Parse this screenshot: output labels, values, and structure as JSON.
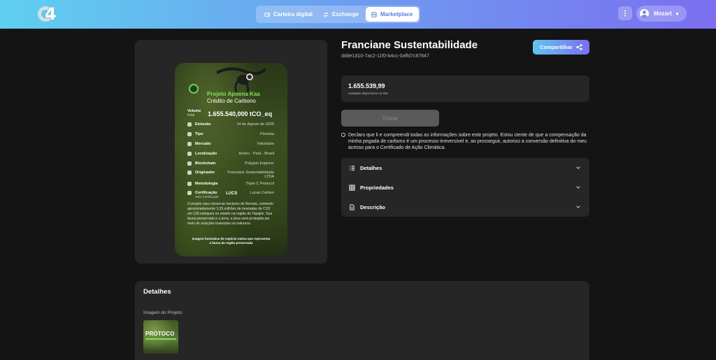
{
  "nav": {
    "tabs": [
      {
        "label": "Carteira digital",
        "icon": "wallet-icon"
      },
      {
        "label": "Exchange",
        "icon": "exchange-arrows-icon"
      },
      {
        "label": "Marketplace",
        "icon": "storefront-icon"
      }
    ],
    "active_tab": "Marketplace",
    "user_name": "Mozart"
  },
  "colors": {
    "header_gradient_start": "#5fd0f0",
    "header_gradient_end": "#7b6ef0",
    "accent_green": "#7fe05a",
    "background": "#141414",
    "panel": "#262626"
  },
  "project": {
    "title": "Franciane Sustentabilidade",
    "id": "ddde1d10-7ac2-11f0-b4cc-0affd7c87847",
    "share_label": "Compartilhar",
    "available_amount": "1.655.539,99",
    "available_label": "unidades disponíveis no lote",
    "trade_label": "Trocar",
    "consent_text": "Declaro que li e compreendi todas as informações sobre este projeto. Estou ciente de que a compensação da minha pegada de carbono é um processo irreversível e, ao prosseguir, autorizo a conversão definitiva do meu acesso para o Certificado de Ação Climática."
  },
  "accordion": [
    {
      "label": "Detalhes",
      "icon": "list-icon"
    },
    {
      "label": "Propriedades",
      "icon": "grid-icon"
    },
    {
      "label": "Descrição",
      "icon": "document-icon"
    }
  ],
  "nft_card": {
    "title": "Projeto Apoena Kaa",
    "subtitle": "Crédito de Carbono",
    "volume_label": "Volume",
    "volume_sublabel": "total",
    "volume_value": "1.655.540,000 tCO_eq",
    "rows": [
      {
        "key": "Emissão",
        "value": "14 de Agosto de 2025"
      },
      {
        "key": "Tipo",
        "value": "Floresta"
      },
      {
        "key": "Mercado",
        "value": "Voluntário"
      },
      {
        "key": "Localização",
        "value": "Aveiro - Pará - Brasil"
      },
      {
        "key": "Blockchain",
        "value": "Polygon Explorer"
      },
      {
        "key": "Originador",
        "value": "Franciane Sustentabilidade LTDA"
      },
      {
        "key": "Metodologia",
        "value": "Triple C Protocol"
      },
      {
        "key": "Certificação",
        "value": "Lucas Carbon"
      }
    ],
    "certification_sub": "Selo Certificação",
    "cert_logo_text": "LUCS",
    "description": "O projeto visa conservar hectares de floresta, contendo aproximadamente 3,29 milhões de toneladas de CO2 em 139 estoques no estado na região do Tapajós. Sua fauna preservada e a terra, a área será protegida por meio de soluções baseadas na natureza.",
    "footer": "Imagem ilustrativa de espécie nativa que representa a fauna da região preservada"
  },
  "details_section": {
    "heading": "Detalhes",
    "image_label": "Imagem do Projeto:",
    "thumb_text": "PROTOCO"
  }
}
